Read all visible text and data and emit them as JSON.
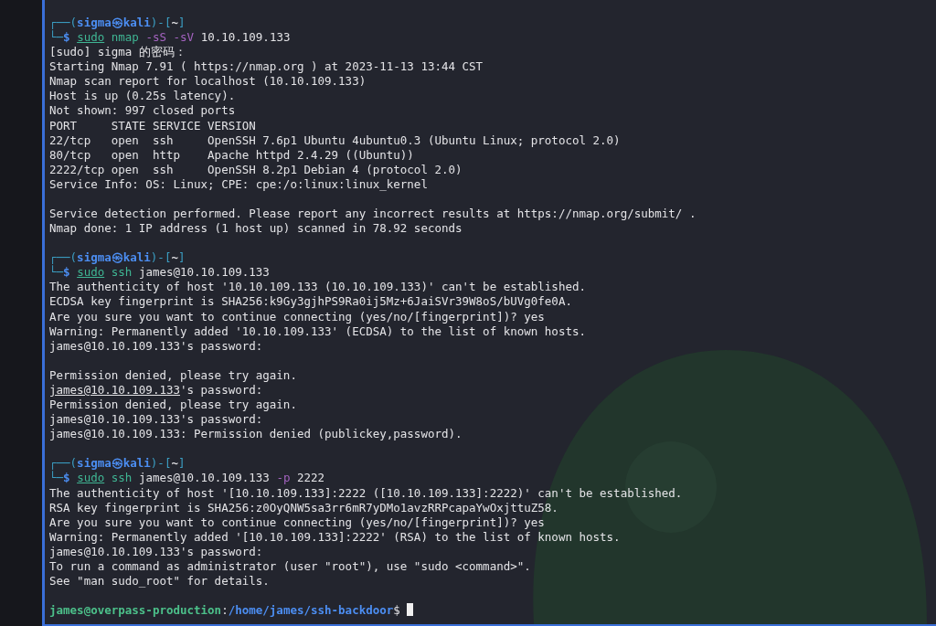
{
  "terminal": {
    "cursor_shown": true,
    "lines": [
      {
        "kind": "text",
        "segments": [
          {
            "text": "┌──(",
            "kind": "frame"
          },
          {
            "text": "sigma㉿kali",
            "kind": "user"
          },
          {
            "text": ")-[",
            "kind": "frame"
          },
          {
            "text": "~",
            "kind": "dir"
          },
          {
            "text": "]",
            "kind": "frame"
          }
        ]
      },
      {
        "kind": "text",
        "segments": [
          {
            "text": "└─",
            "kind": "frame"
          },
          {
            "text": "$",
            "kind": "dollar"
          },
          {
            "text": "sudo",
            "kind": "sudo"
          },
          {
            "text": "nmap",
            "kind": "command"
          },
          {
            "text": "-sS -sV",
            "kind": "option"
          },
          {
            "text": "10.10.109.133",
            "kind": "plain"
          }
        ]
      },
      {
        "kind": "text",
        "segments": [
          {
            "text": "[sudo] sigma 的密码：",
            "kind": "plain"
          }
        ]
      },
      {
        "kind": "text",
        "segments": [
          {
            "text": "Starting Nmap 7.91 ( https://nmap.org ) at 2023-11-13 13:44 CST",
            "kind": "plain"
          }
        ]
      },
      {
        "kind": "text",
        "segments": [
          {
            "text": "Nmap scan report for localhost (10.10.109.133)",
            "kind": "plain"
          }
        ]
      },
      {
        "kind": "text",
        "segments": [
          {
            "text": "Host is up (0.25s latency).",
            "kind": "plain"
          }
        ]
      },
      {
        "kind": "text",
        "segments": [
          {
            "text": "Not shown: 997 closed ports",
            "kind": "plain"
          }
        ]
      },
      {
        "kind": "text",
        "segments": [
          {
            "text": "PORT     STATE SERVICE VERSION",
            "kind": "plain"
          }
        ]
      },
      {
        "kind": "text",
        "segments": [
          {
            "text": "22/tcp   open  ssh     OpenSSH 7.6p1 Ubuntu 4ubuntu0.3 (Ubuntu Linux; protocol 2.0)",
            "kind": "plain"
          }
        ]
      },
      {
        "kind": "text",
        "segments": [
          {
            "text": "80/tcp   open  http    Apache httpd 2.4.29 ((Ubuntu))",
            "kind": "plain"
          }
        ]
      },
      {
        "kind": "text",
        "segments": [
          {
            "text": "2222/tcp open  ssh     OpenSSH 8.2p1 Debian 4 (protocol 2.0)",
            "kind": "plain"
          }
        ]
      },
      {
        "kind": "text",
        "segments": [
          {
            "text": "Service Info: OS: Linux; CPE: cpe:/o:linux:linux_kernel",
            "kind": "plain"
          }
        ]
      },
      {
        "kind": "blank"
      },
      {
        "kind": "text",
        "segments": [
          {
            "text": "Service detection performed. Please report any incorrect results at https://nmap.org/submit/ .",
            "kind": "plain"
          }
        ]
      },
      {
        "kind": "text",
        "segments": [
          {
            "text": "Nmap done: 1 IP address (1 host up) scanned in 78.92 seconds",
            "kind": "plain"
          }
        ]
      },
      {
        "kind": "blank"
      },
      {
        "kind": "text",
        "segments": [
          {
            "text": "┌──(",
            "kind": "frame"
          },
          {
            "text": "sigma㉿kali",
            "kind": "user"
          },
          {
            "text": ")-[",
            "kind": "frame"
          },
          {
            "text": "~",
            "kind": "dir"
          },
          {
            "text": "]",
            "kind": "frame"
          }
        ]
      },
      {
        "kind": "text",
        "segments": [
          {
            "text": "└─",
            "kind": "frame"
          },
          {
            "text": "$",
            "kind": "dollar"
          },
          {
            "text": "sudo",
            "kind": "sudo"
          },
          {
            "text": "ssh",
            "kind": "command"
          },
          {
            "text": "james@10.10.109.133",
            "kind": "plain"
          }
        ]
      },
      {
        "kind": "text",
        "segments": [
          {
            "text": "The authenticity of host '10.10.109.133 (10.10.109.133)' can't be established.",
            "kind": "plain"
          }
        ]
      },
      {
        "kind": "text",
        "segments": [
          {
            "text": "ECDSA key fingerprint is SHA256:k9Gy3gjhPS9Ra0ij5Mz+6JaiSVr39W8oS/bUVg0fe0A.",
            "kind": "plain"
          }
        ]
      },
      {
        "kind": "text",
        "segments": [
          {
            "text": "Are you sure you want to continue connecting (yes/no/[fingerprint])? yes",
            "kind": "plain"
          }
        ]
      },
      {
        "kind": "text",
        "segments": [
          {
            "text": "Warning: Permanently added '10.10.109.133' (ECDSA) to the list of known hosts.",
            "kind": "plain"
          }
        ]
      },
      {
        "kind": "text",
        "segments": [
          {
            "text": "james@10.10.109.133's password:",
            "kind": "plain"
          }
        ]
      },
      {
        "kind": "blank"
      },
      {
        "kind": "text",
        "segments": [
          {
            "text": "Permission denied, please try again.",
            "kind": "plain"
          }
        ]
      },
      {
        "kind": "text",
        "segments": [
          {
            "text": "james@10.10.109.133",
            "kind": "link"
          },
          {
            "text": "'s password:",
            "kind": "tail"
          }
        ]
      },
      {
        "kind": "text",
        "segments": [
          {
            "text": "Permission denied, please try again.",
            "kind": "plain"
          }
        ]
      },
      {
        "kind": "text",
        "segments": [
          {
            "text": "james@10.10.109.133's password:",
            "kind": "plain"
          }
        ]
      },
      {
        "kind": "text",
        "segments": [
          {
            "text": "james@10.10.109.133: Permission denied (publickey,password).",
            "kind": "plain"
          }
        ]
      },
      {
        "kind": "blank"
      },
      {
        "kind": "text",
        "segments": [
          {
            "text": "┌──(",
            "kind": "frame"
          },
          {
            "text": "sigma㉿kali",
            "kind": "user"
          },
          {
            "text": ")-[",
            "kind": "frame"
          },
          {
            "text": "~",
            "kind": "dir"
          },
          {
            "text": "]",
            "kind": "frame"
          }
        ]
      },
      {
        "kind": "text",
        "segments": [
          {
            "text": "└─",
            "kind": "frame"
          },
          {
            "text": "$",
            "kind": "dollar"
          },
          {
            "text": "sudo",
            "kind": "sudo"
          },
          {
            "text": "ssh",
            "kind": "command"
          },
          {
            "text": "james@10.10.109.133",
            "kind": "plain"
          },
          {
            "text": "-p",
            "kind": "option"
          },
          {
            "text": "2222",
            "kind": "plain"
          }
        ]
      },
      {
        "kind": "text",
        "segments": [
          {
            "text": "The authenticity of host '[10.10.109.133]:2222 ([10.10.109.133]:2222)' can't be established.",
            "kind": "plain"
          }
        ]
      },
      {
        "kind": "text",
        "segments": [
          {
            "text": "RSA key fingerprint is SHA256:z0OyQNW5sa3rr6mR7yDMo1avzRRPcapaYwOxjttuZ58.",
            "kind": "plain"
          }
        ]
      },
      {
        "kind": "text",
        "segments": [
          {
            "text": "Are you sure you want to continue connecting (yes/no/[fingerprint])? yes",
            "kind": "plain"
          }
        ]
      },
      {
        "kind": "text",
        "segments": [
          {
            "text": "Warning: Permanently added '[10.10.109.133]:2222' (RSA) to the list of known hosts.",
            "kind": "plain"
          }
        ]
      },
      {
        "kind": "text",
        "segments": [
          {
            "text": "james@10.10.109.133's password:",
            "kind": "plain"
          }
        ]
      },
      {
        "kind": "text",
        "segments": [
          {
            "text": "To run a command as administrator (user \"root\"), use \"sudo <command>\".",
            "kind": "plain"
          }
        ]
      },
      {
        "kind": "text",
        "segments": [
          {
            "text": "See \"man sudo_root\" for details.",
            "kind": "plain"
          }
        ]
      },
      {
        "kind": "blank"
      },
      {
        "kind": "text",
        "segments": [
          {
            "text": "james@overpass-production",
            "kind": "shell_user"
          },
          {
            "text": ":",
            "kind": "shell_colon"
          },
          {
            "text": "/home/james/ssh-backdoor",
            "kind": "shell_path"
          },
          {
            "text": "$",
            "kind": "shell_dollar"
          }
        ]
      }
    ]
  }
}
